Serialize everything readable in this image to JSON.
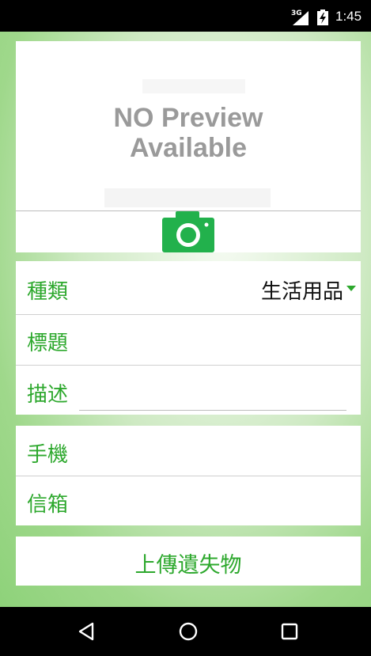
{
  "status_bar": {
    "network": "3G",
    "time": "1:45"
  },
  "preview": {
    "line1": "NO Preview",
    "line2": "Available"
  },
  "form": {
    "category_label": "種類",
    "category_value": "生活用品",
    "title_label": "標題",
    "description_label": "描述",
    "phone_label": "手機",
    "email_label": "信箱"
  },
  "submit_label": "上傳遺失物",
  "colors": {
    "accent": "#2da82d",
    "camera": "#22b14c",
    "placeholder_text": "#9a9a9a"
  },
  "icons": {
    "camera": "camera-icon",
    "back": "back-triangle-icon",
    "home": "home-circle-icon",
    "recents": "recents-square-icon"
  }
}
